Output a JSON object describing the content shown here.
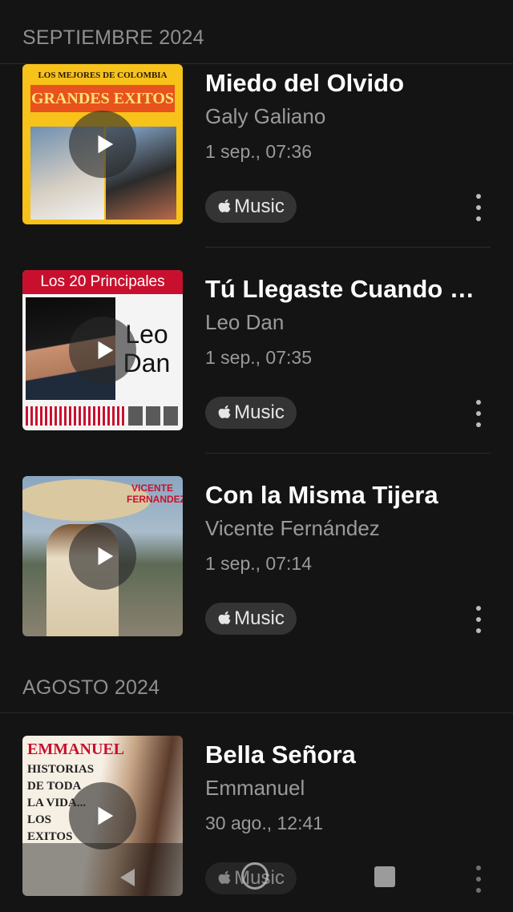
{
  "sections": [
    {
      "label": "SEPTIEMBRE 2024"
    },
    {
      "label": "AGOSTO 2024"
    }
  ],
  "tracks": [
    {
      "title": "Miedo del Olvido",
      "artist": "Galy Galiano",
      "date": "1 sep., 07:36",
      "service": "Music",
      "cover": {
        "top_text": "LOS MEJORES DE COLOMBIA",
        "main_text": "GRANDES EXITOS"
      }
    },
    {
      "title": "Tú Llegaste Cuando Me Fui",
      "artist": "Leo Dan",
      "date": "1 sep., 07:35",
      "service": "Music",
      "cover": {
        "top_text": "Los 20 Principales",
        "main_text": "Leo Dan"
      }
    },
    {
      "title": "Con la Misma Tijera",
      "artist": "Vicente Fernández",
      "date": "1 sep., 07:14",
      "service": "Music",
      "cover": {
        "top_text": "VICENTE FERNANDEZ"
      }
    },
    {
      "title": "Bella Señora",
      "artist": "Emmanuel",
      "date": "30 ago., 12:41",
      "service": "Music",
      "cover": {
        "top_text": "EMMANUEL",
        "main_text": "HISTORIAS DE TODA LA VIDA... LOS EXITOS"
      }
    }
  ],
  "colors": {
    "background": "#141414",
    "secondary_text": "#9a9a9a",
    "badge_bg": "#343434"
  }
}
